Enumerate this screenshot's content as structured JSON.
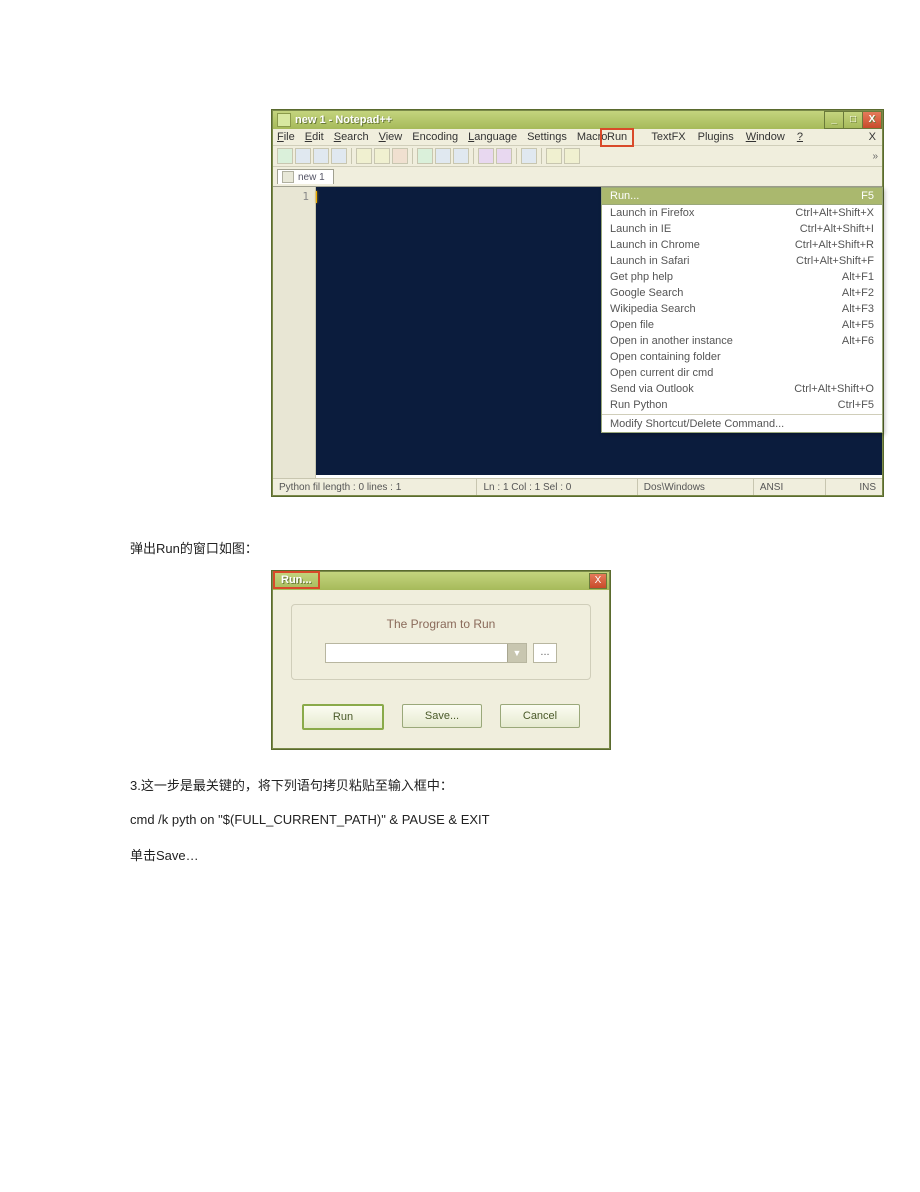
{
  "main_window": {
    "title": "new  1 - Notepad++",
    "menus": {
      "file": "File",
      "edit": "Edit",
      "search": "Search",
      "view": "View",
      "encoding": "Encoding",
      "language": "Language",
      "settings": "Settings",
      "macro": "Macro",
      "run": "Run",
      "textfx": "TextFX",
      "plugins": "Plugins",
      "window": "Window",
      "help": "?"
    },
    "close_x": "X",
    "tab": "new  1",
    "gutter_line": "1",
    "run_menu": {
      "highlighted": {
        "label": "Run...",
        "shortcut": "F5"
      },
      "items": [
        {
          "label": "Launch in Firefox",
          "shortcut": "Ctrl+Alt+Shift+X"
        },
        {
          "label": "Launch in IE",
          "shortcut": "Ctrl+Alt+Shift+I"
        },
        {
          "label": "Launch in Chrome",
          "shortcut": "Ctrl+Alt+Shift+R"
        },
        {
          "label": "Launch in Safari",
          "shortcut": "Ctrl+Alt+Shift+F"
        },
        {
          "label": "Get php help",
          "shortcut": "Alt+F1"
        },
        {
          "label": "Google Search",
          "shortcut": "Alt+F2"
        },
        {
          "label": "Wikipedia Search",
          "shortcut": "Alt+F3"
        },
        {
          "label": "Open file",
          "shortcut": "Alt+F5"
        },
        {
          "label": "Open in another instance",
          "shortcut": "Alt+F6"
        },
        {
          "label": "Open containing folder",
          "shortcut": ""
        },
        {
          "label": "Open current dir cmd",
          "shortcut": ""
        },
        {
          "label": "Send via Outlook",
          "shortcut": "Ctrl+Alt+Shift+O"
        },
        {
          "label": "Run Python",
          "shortcut": "Ctrl+F5"
        }
      ],
      "footer": "Modify Shortcut/Delete Command..."
    },
    "status": {
      "left": "Python fil length : 0    lines : 1",
      "mid": "Ln : 1    Col : 1    Sel : 0",
      "enc": "Dos\\Windows",
      "charset": "ANSI",
      "ins": "INS"
    }
  },
  "caption1": "弹出Run的窗口如图：",
  "dialog": {
    "title": "Run...",
    "heading": "The Program to Run",
    "browse": "...",
    "buttons": {
      "run": "Run",
      "save": "Save...",
      "cancel": "Cancel"
    }
  },
  "step3": "3.这一步是最关键的，将下列语句拷贝粘贴至输入框中：",
  "cmd": "cmd /k pyth on \"$(FULL_CURRENT_PATH)\" & PAUSE & EXIT",
  "save_line": "单击Save…"
}
